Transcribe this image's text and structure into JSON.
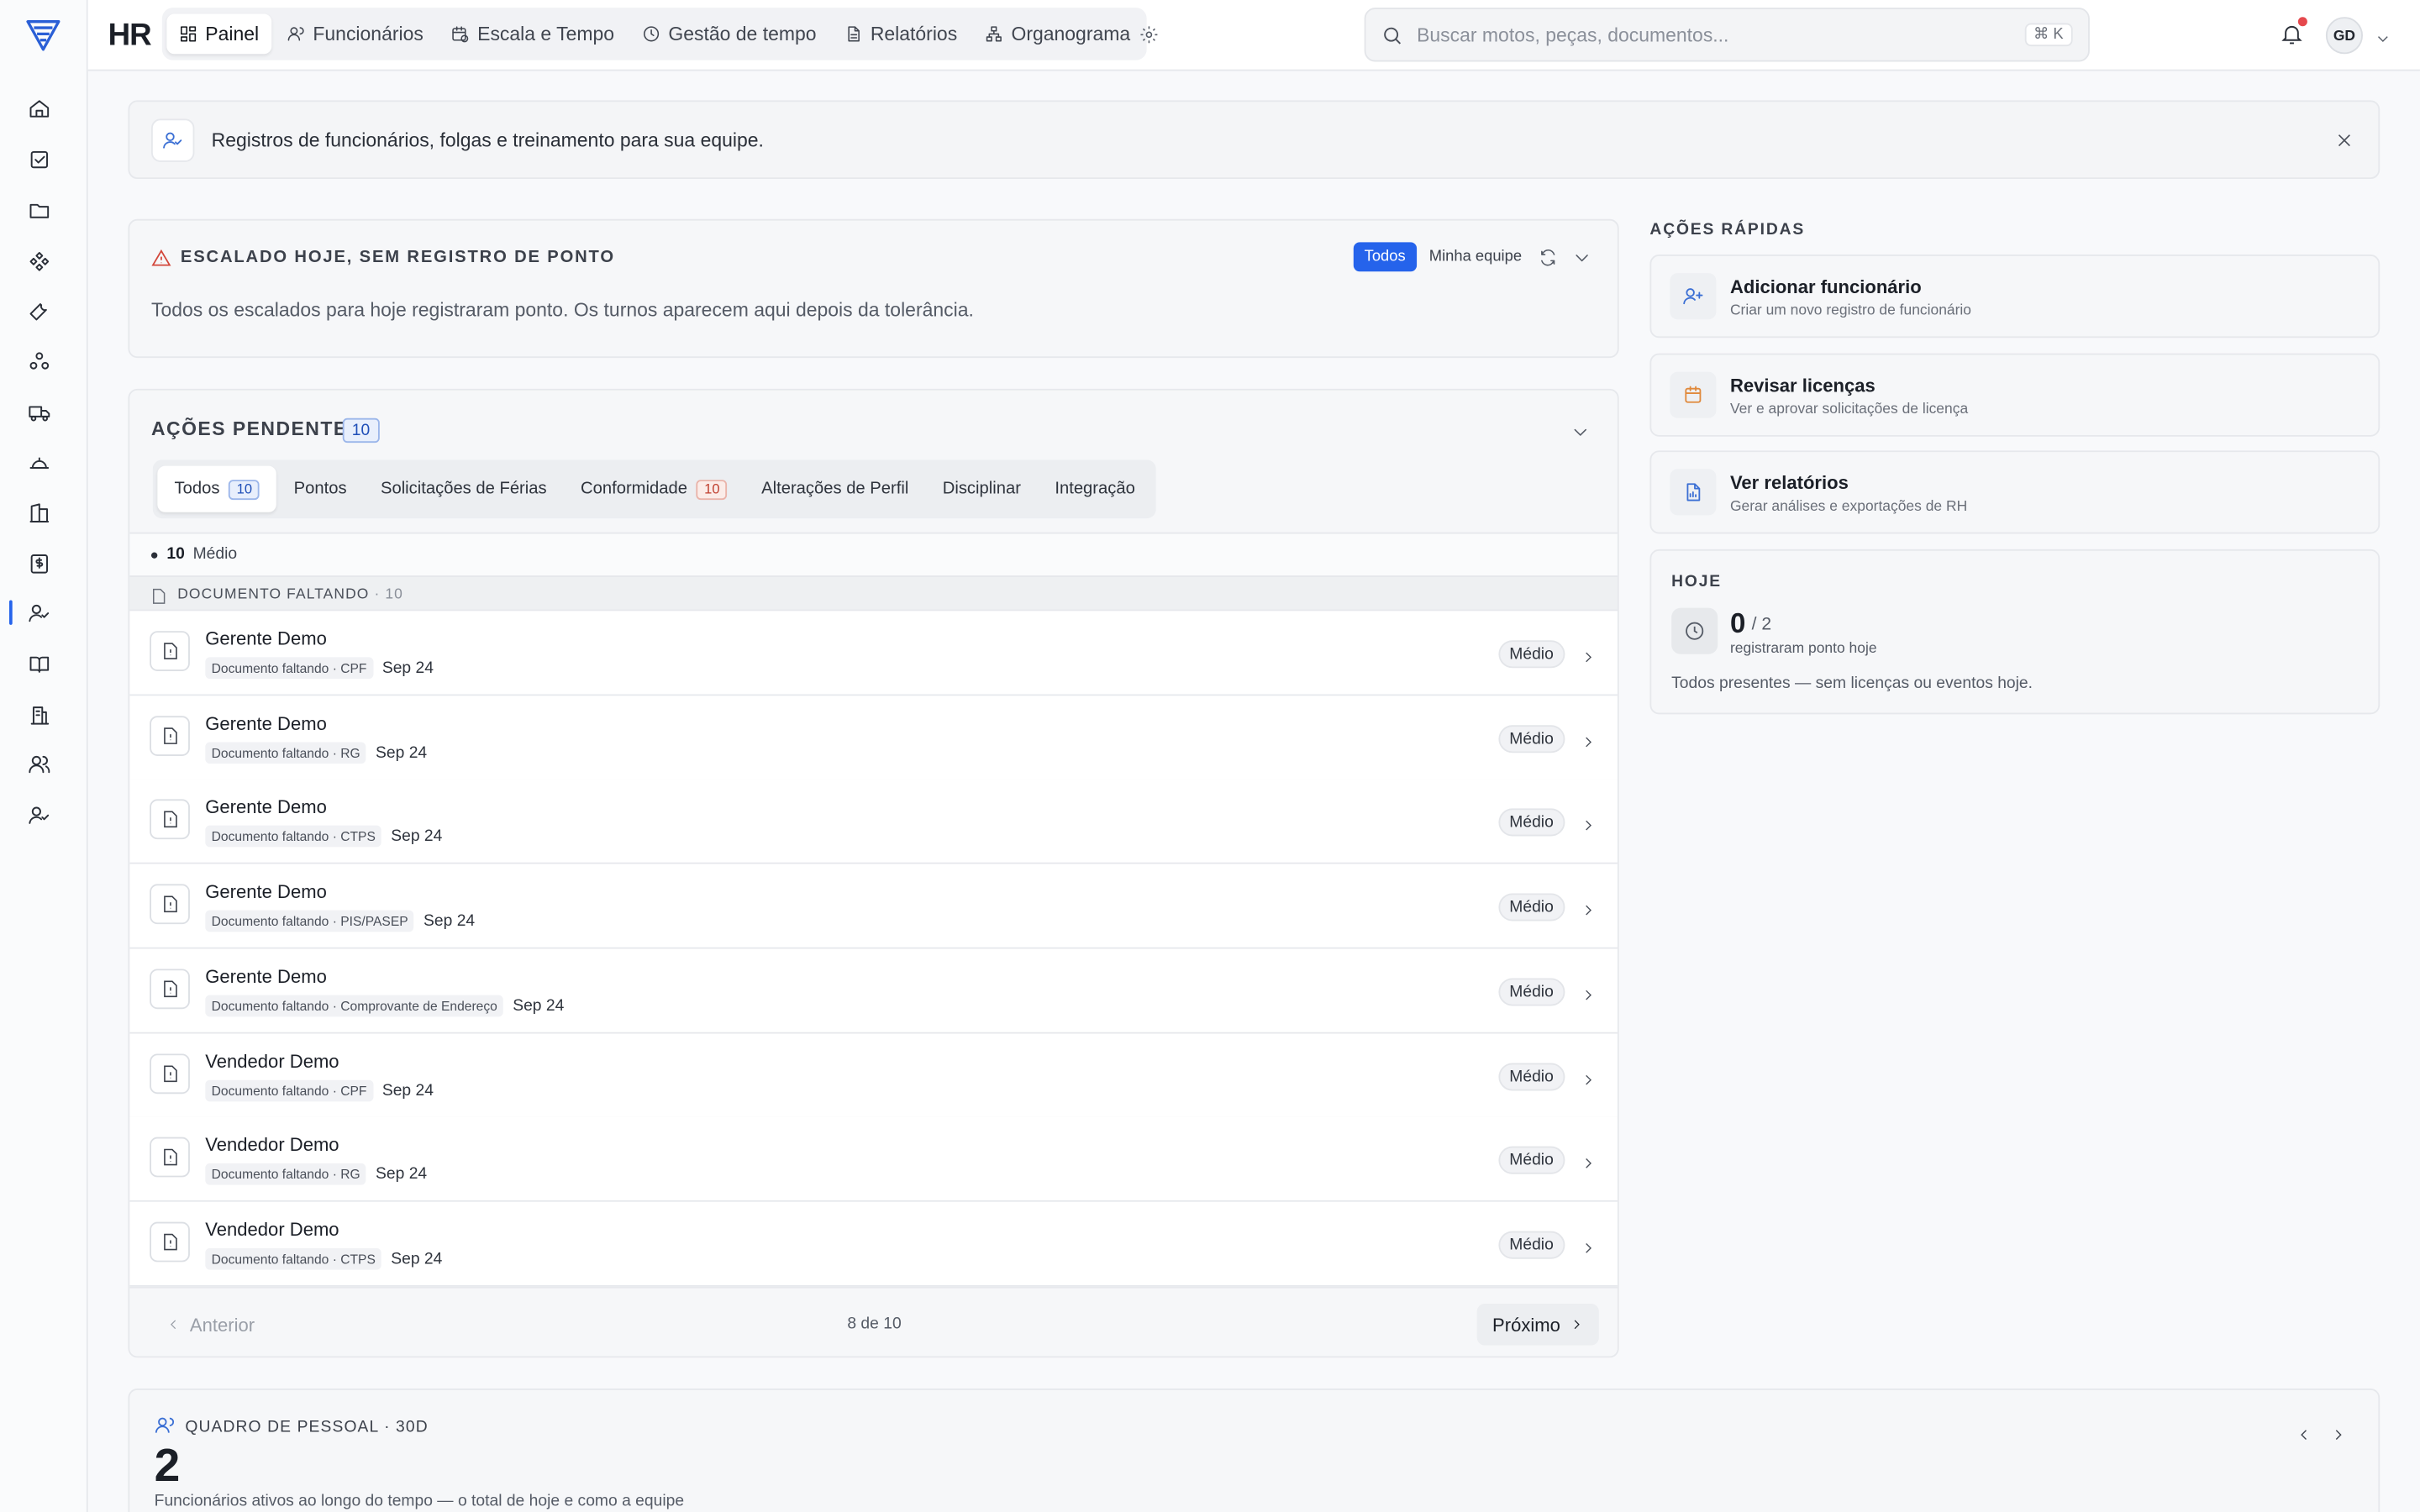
{
  "app": {
    "title": "HR"
  },
  "nav": {
    "tabs": [
      {
        "label": "Painel",
        "icon": "dashboard-icon",
        "active": true
      },
      {
        "label": "Funcionários",
        "icon": "users-icon"
      },
      {
        "label": "Escala e Tempo",
        "icon": "calendar-clock-icon"
      },
      {
        "label": "Gestão de tempo",
        "icon": "clock-icon"
      },
      {
        "label": "Relatórios",
        "icon": "file-icon"
      },
      {
        "label": "Organograma",
        "icon": "org-chart-icon"
      }
    ]
  },
  "search": {
    "placeholder": "Buscar motos, peças, documentos...",
    "shortcut": "⌘ K"
  },
  "user": {
    "initials": "GD"
  },
  "banner": {
    "text": "Registros de funcionários, folgas e treinamento para sua equipe."
  },
  "scheduled": {
    "title": "ESCALADO HOJE, SEM REGISTRO DE PONTO",
    "filter_all": "Todos",
    "filter_team": "Minha equipe",
    "message": "Todos os escalados para hoje registraram ponto. Os turnos aparecem aqui depois da tolerância."
  },
  "pending": {
    "title": "AÇÕES PENDENTES",
    "count": "10",
    "tabs": [
      {
        "label": "Todos",
        "badge": "10",
        "badge_color": "blue",
        "active": true
      },
      {
        "label": "Pontos"
      },
      {
        "label": "Solicitações de Férias"
      },
      {
        "label": "Conformidade",
        "badge": "10",
        "badge_color": "red"
      },
      {
        "label": "Alterações de Perfil"
      },
      {
        "label": "Disciplinar"
      },
      {
        "label": "Integração"
      }
    ],
    "severity": {
      "count": "10",
      "label": "Médio"
    },
    "group": {
      "label": "DOCUMENTO FALTANDO",
      "count": "· 10"
    },
    "items": [
      {
        "name": "Gerente Demo",
        "meta": "Documento faltando · CPF",
        "date": "Sep 24",
        "badge": "Médio"
      },
      {
        "name": "Gerente Demo",
        "meta": "Documento faltando · RG",
        "date": "Sep 24",
        "badge": "Médio"
      },
      {
        "name": "Gerente Demo",
        "meta": "Documento faltando · CTPS",
        "date": "Sep 24",
        "badge": "Médio"
      },
      {
        "name": "Gerente Demo",
        "meta": "Documento faltando · PIS/PASEP",
        "date": "Sep 24",
        "badge": "Médio"
      },
      {
        "name": "Gerente Demo",
        "meta": "Documento faltando · Comprovante de Endereço",
        "date": "Sep 24",
        "badge": "Médio"
      },
      {
        "name": "Vendedor Demo",
        "meta": "Documento faltando · CPF",
        "date": "Sep 24",
        "badge": "Médio"
      },
      {
        "name": "Vendedor Demo",
        "meta": "Documento faltando · RG",
        "date": "Sep 24",
        "badge": "Médio"
      },
      {
        "name": "Vendedor Demo",
        "meta": "Documento faltando · CTPS",
        "date": "Sep 24",
        "badge": "Médio"
      }
    ],
    "pager": {
      "prev": "Anterior",
      "info": "8 de 10",
      "next": "Próximo"
    }
  },
  "quick_actions": {
    "label": "AÇÕES RÁPIDAS",
    "items": [
      {
        "title": "Adicionar funcionário",
        "sub": "Criar um novo registro de funcionário",
        "icon": "user-plus-icon",
        "color": "#3b6fd4"
      },
      {
        "title": "Revisar licenças",
        "sub": "Ver e aprovar solicitações de licença",
        "icon": "calendar-icon",
        "color": "#e0893b"
      },
      {
        "title": "Ver relatórios",
        "sub": "Gerar análises e exportações de RH",
        "icon": "report-icon",
        "color": "#3b6fd4"
      }
    ]
  },
  "today": {
    "label": "HOJE",
    "num": "0",
    "den": "/ 2",
    "sub": "registraram ponto hoje",
    "message": "Todos presentes — sem licenças ou eventos hoje."
  },
  "headcount": {
    "label": "QUADRO DE PESSOAL · 30D",
    "num": "2",
    "sub": "Funcionários ativos ao longo do tempo — o total de hoje e como a equipe"
  },
  "colors": {
    "accent": "#2563eb",
    "danger": "#d2463a",
    "notify": "#e5484d"
  }
}
